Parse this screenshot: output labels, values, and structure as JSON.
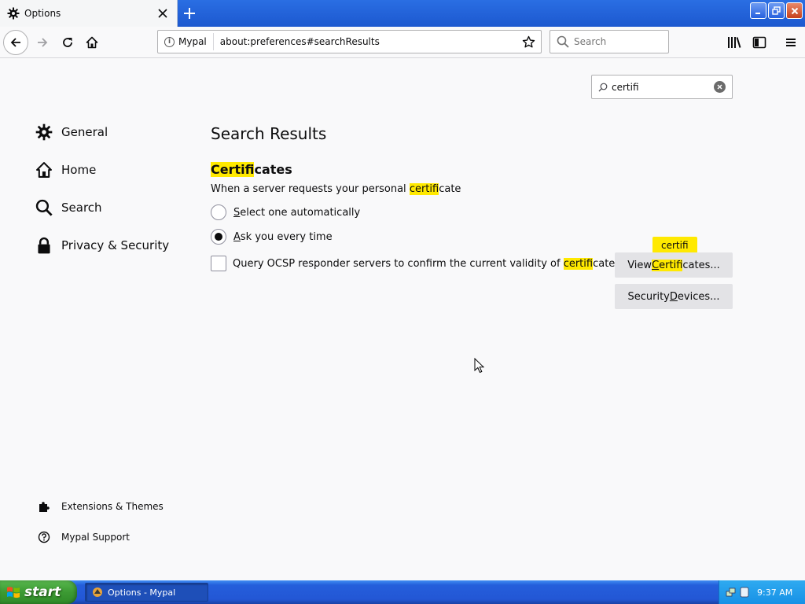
{
  "browser": {
    "tab_title": "Options",
    "identity_label": "Mypal",
    "url": "about:preferences#searchResults",
    "search_placeholder": "Search"
  },
  "preferences": {
    "find_query": "certifi",
    "categories": [
      {
        "label": "General",
        "icon": "gear-icon"
      },
      {
        "label": "Home",
        "icon": "home-icon"
      },
      {
        "label": "Search",
        "icon": "search-icon"
      },
      {
        "label": "Privacy & Security",
        "icon": "lock-icon"
      }
    ],
    "footer_links": [
      {
        "label": "Extensions & Themes",
        "icon": "puzzle-icon"
      },
      {
        "label": "Mypal Support",
        "icon": "help-icon"
      }
    ],
    "heading": "Search Results",
    "group": {
      "title_highlight": "Certifi",
      "title_rest": "cates",
      "description_before": "When a server requests your personal ",
      "description_highlight": "certifi",
      "description_after": "cate",
      "radio_options": [
        {
          "access_key": "S",
          "rest": "elect one automatically",
          "checked": false
        },
        {
          "access_key": "A",
          "rest": "sk you every time",
          "checked": true
        }
      ],
      "ocsp_before": "Query OCSP responder servers to confirm the current validity of ",
      "ocsp_highlight": "certifi",
      "ocsp_after": "cates",
      "ocsp_checked": false,
      "tooltip": "certifi",
      "view_button": {
        "before": "View ",
        "access_key": "C",
        "highlight_rest": "ertifi",
        "after": "cates..."
      },
      "devices_button": {
        "before": "Security ",
        "access_key": "D",
        "after": "evices..."
      }
    }
  },
  "taskbar": {
    "start_label": "start",
    "task_label": "Options - Mypal",
    "clock": "9:37 AM"
  },
  "colors": {
    "highlight": "#ffe900",
    "titlebar": "#1c58cf",
    "taskbar": "#245edb",
    "start": "#3c9a33"
  }
}
